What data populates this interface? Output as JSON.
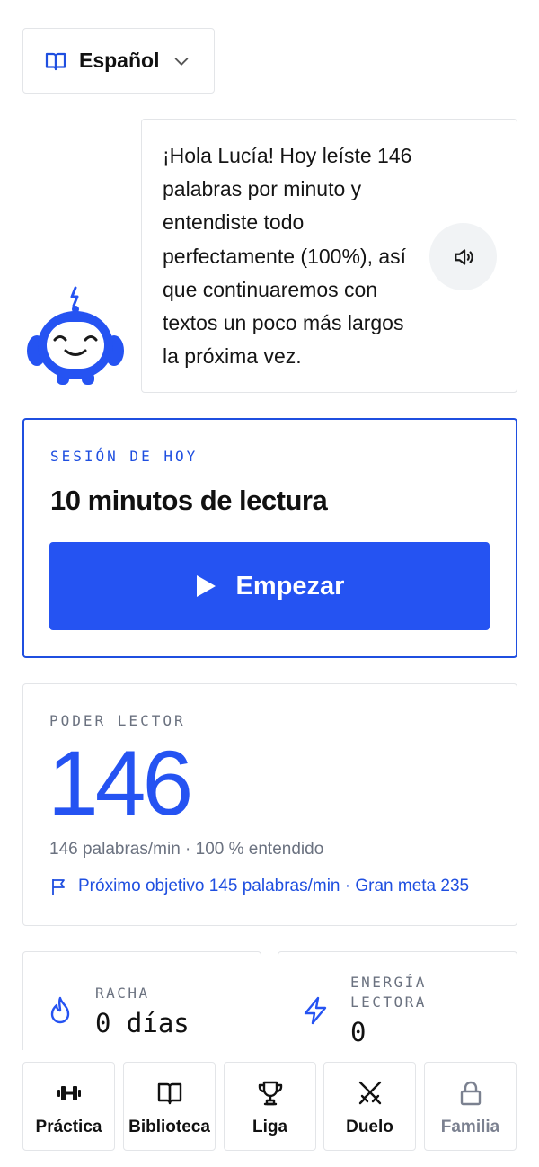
{
  "language_selector": {
    "label": "Español"
  },
  "message": {
    "text": "¡Hola Lucía! Hoy leíste 146 palabras por minuto y entendiste todo perfectamente (100%), así que continuaremos con textos un poco más largos la próxima vez."
  },
  "session": {
    "kicker": "SESIÓN DE HOY",
    "title": "10 minutos de lectura",
    "start_label": "Empezar"
  },
  "reading_power": {
    "kicker": "PODER LECTOR",
    "value": "146",
    "stats": "146 palabras/min · 100 % entendido",
    "goal": "Próximo objetivo 145 palabras/min · Gran meta 235"
  },
  "streak": {
    "label": "RACHA",
    "value": "0 días"
  },
  "energy": {
    "label_line1": "ENERGÍA",
    "label_line2": "LECTORA",
    "value": "0"
  },
  "nav": [
    {
      "label": "Práctica",
      "icon": "dumbbell-icon"
    },
    {
      "label": "Biblioteca",
      "icon": "book-icon"
    },
    {
      "label": "Liga",
      "icon": "trophy-icon"
    },
    {
      "label": "Duelo",
      "icon": "crossed-swords-icon"
    },
    {
      "label": "Familia",
      "icon": "lock-icon"
    }
  ],
  "colors": {
    "accent": "#2553f2",
    "border": "#e3e5e8",
    "muted": "#6b7280"
  }
}
